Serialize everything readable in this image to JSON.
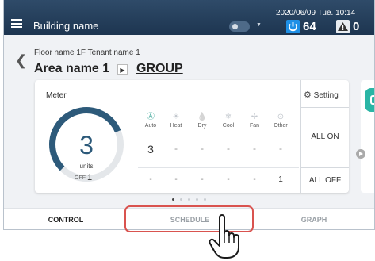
{
  "header": {
    "building_name": "Building name",
    "datetime": "2020/06/09 Tue. 10:14",
    "power_count": "64",
    "warning_count": "0",
    "icons": [
      "menu-icon",
      "power-icon",
      "warning-icon"
    ]
  },
  "location": {
    "floor": "Floor name 1F Tenant name 1",
    "area": "Area name 1",
    "group_link": "GROUP"
  },
  "meter": {
    "label": "Meter",
    "units_value": "3",
    "units_label": "units",
    "off_label": "OFF",
    "off_value": "1",
    "gauge_fraction": 0.75
  },
  "modes": [
    {
      "name": "Auto",
      "icon": "Ⓐ",
      "count": "3",
      "off": "-"
    },
    {
      "name": "Heat",
      "icon": "☀",
      "count": "-",
      "off": "-"
    },
    {
      "name": "Dry",
      "icon": "💧",
      "count": "-",
      "off": "-"
    },
    {
      "name": "Cool",
      "icon": "❄",
      "count": "-",
      "off": "-"
    },
    {
      "name": "Fan",
      "icon": "✢",
      "count": "-",
      "off": "-"
    },
    {
      "name": "Other",
      "icon": "⊙",
      "count": "-",
      "off": "1"
    }
  ],
  "actions": {
    "setting": "Setting",
    "all_on": "ALL ON",
    "all_off": "ALL OFF"
  },
  "tabs": {
    "control": "CONTROL",
    "schedule": "SCHEDULE",
    "graph": "GRAPH"
  },
  "colors": {
    "header": "#1d3550",
    "accent": "#2a9d8f",
    "gauge": "#2d5a7a",
    "highlight": "#d9534f"
  }
}
